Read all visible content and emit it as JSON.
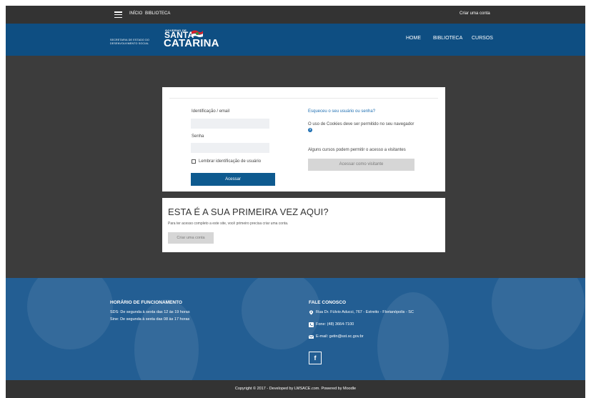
{
  "topnav": {
    "inicio": "INÍCIO",
    "biblioteca": "BIBLIOTECA",
    "criar_conta": "Criar uma conta"
  },
  "header": {
    "logo_line1": "SECRETARIA DE ESTADO DO",
    "logo_line2": "DESENVOLVIMENTO SOCIAL",
    "logo_gov": "GOVERNO DE",
    "logo_santa": "SANTA",
    "logo_catarina": "CATARINA",
    "nav": {
      "home": "HOME",
      "biblioteca": "BIBLIOTECA",
      "cursos": "CURSOS"
    }
  },
  "login": {
    "username_label": "Identificação / email",
    "username_value": "",
    "password_label": "Senha",
    "password_value": "",
    "remember_label": "Lembrar identificação de usuário",
    "submit_label": "Acessar",
    "forgot_link": "Esqueceu o seu usuário ou senha?",
    "cookies_text": "O uso de Cookies deve ser permitido no seu navegador",
    "guest_text": "Alguns cursos podem permitir o acesso a visitantes",
    "guest_button": "Acessar como visitante"
  },
  "first_time": {
    "title": "ESTA É A SUA PRIMEIRA VEZ AQUI?",
    "text": "Para ter acesso completo a este site, você primeiro precisa criar uma conta.",
    "button": "Criar uma conta"
  },
  "footer": {
    "hours_title": "HORÁRIO DE FUNCIONAMENTO",
    "hours_line1": "SDS: De segunda à sexta das 12 às 19 horas",
    "hours_line2": "Sine: De segunda à sexta das 08 às 17 horas",
    "contact_title": "FALE CONOSCO",
    "address": "Rua Dr. Fúlvio Aducci, 767 - Estreito - Florianópolis - SC",
    "phone": "Fone: (48) 3664-7100",
    "email": "E-mail: getin@sst.sc.gov.br",
    "facebook": "f"
  },
  "copyright": "Copyright © 2017 - Developed by LMSACE.com. Powered by Moodle",
  "colors": {
    "header_blue": "#0e4e82",
    "dark_bar": "#333333",
    "primary_button": "#0e5a8f",
    "link": "#1f6fb2"
  }
}
